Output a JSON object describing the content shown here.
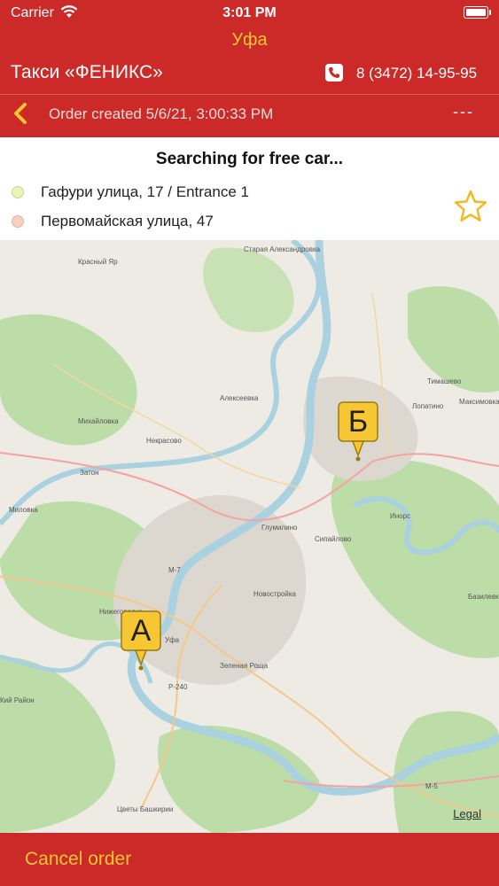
{
  "status": {
    "carrier": "Carrier",
    "time": "3:01 PM"
  },
  "header": {
    "city": "Уфа",
    "company": "Такси «ФЕНИКС»",
    "phone": "8 (3472) 14-95-95",
    "order_status": "Order created 5/6/21, 3:00:33 PM",
    "dashes": "---"
  },
  "order": {
    "status_text": "Searching for free car...",
    "from": "Гафури улица, 17 / Entrance 1",
    "to": "Первомайская улица, 47"
  },
  "map": {
    "marker_a": "А",
    "marker_b": "Б",
    "legal": "Legal",
    "labels": [
      "Старая Александровка",
      "Красный Яр",
      "Алексеевка",
      "Михайловка",
      "Некрасово",
      "Затон",
      "Миловка",
      "Тимашево",
      "Лопатино",
      "Максимовка",
      "Глумилино",
      "Сипайлово",
      "Инорс",
      "Новостройка",
      "Нижегородка",
      "Уфа",
      "Зеленая Роща",
      "Цветы Башкирии",
      "Кий Район",
      "Базилевка",
      "М-7",
      "М-5",
      "Р-240",
      "Кий Район"
    ]
  },
  "colors": {
    "header_bg": "#CC2A28",
    "accent_yellow": "#F6C733",
    "water": "#A9D1E0",
    "forest": "#BCDCA8"
  },
  "footer": {
    "cancel": "Cancel order"
  }
}
